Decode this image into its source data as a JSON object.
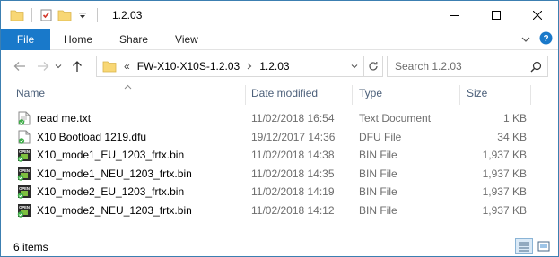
{
  "window": {
    "title": "1.2.03"
  },
  "ribbon": {
    "tabs": [
      "File",
      "Home",
      "Share",
      "View"
    ]
  },
  "address": {
    "overflow": "«",
    "crumbs": [
      "FW-X10-X10S-1.2.03",
      "1.2.03"
    ]
  },
  "search": {
    "placeholder": "Search 1.2.03"
  },
  "columns": {
    "name": "Name",
    "date": "Date modified",
    "type": "Type",
    "size": "Size"
  },
  "files": [
    {
      "name": "read me.txt",
      "date": "11/02/2018 16:54",
      "type": "Text Document",
      "size": "1 KB",
      "icon": "text-file-icon"
    },
    {
      "name": "X10 Bootload 1219.dfu",
      "date": "19/12/2017 14:36",
      "type": "DFU File",
      "size": "34 KB",
      "icon": "generic-file-icon"
    },
    {
      "name": "X10_mode1_EU_1203_frtx.bin",
      "date": "11/02/2018 14:38",
      "type": "BIN File",
      "size": "1,937 KB",
      "icon": "bin-file-icon"
    },
    {
      "name": "X10_mode1_NEU_1203_frtx.bin",
      "date": "11/02/2018 14:35",
      "type": "BIN File",
      "size": "1,937 KB",
      "icon": "bin-file-icon"
    },
    {
      "name": "X10_mode2_EU_1203_frtx.bin",
      "date": "11/02/2018 14:19",
      "type": "BIN File",
      "size": "1,937 KB",
      "icon": "bin-file-icon"
    },
    {
      "name": "X10_mode2_NEU_1203_frtx.bin",
      "date": "11/02/2018 14:12",
      "type": "BIN File",
      "size": "1,937 KB",
      "icon": "bin-file-icon"
    }
  ],
  "status": {
    "item_count": "6 items"
  },
  "colors": {
    "accent": "#1979ca",
    "header_text": "#4c607a",
    "secondary_text": "#6d6d6d",
    "folder": "#f8d775"
  }
}
